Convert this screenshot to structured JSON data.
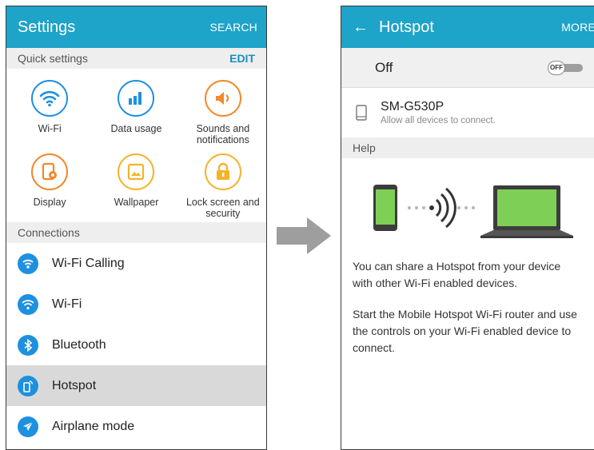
{
  "left_screen": {
    "appbar": {
      "title": "Settings",
      "action": "SEARCH"
    },
    "quick_settings": {
      "header": "Quick settings",
      "edit_label": "EDIT",
      "tiles": [
        {
          "label": "Wi-Fi",
          "icon": "wifi-icon",
          "color": "#1e90e0"
        },
        {
          "label": "Data usage",
          "icon": "bar-chart-icon",
          "color": "#1e90e0"
        },
        {
          "label": "Sounds and\nnotifications",
          "icon": "speaker-icon",
          "color": "#f2882b"
        },
        {
          "label": "Display",
          "icon": "display-gear-icon",
          "color": "#f2882b"
        },
        {
          "label": "Wallpaper",
          "icon": "picture-icon",
          "color": "#f5b32a"
        },
        {
          "label": "Lock screen and\nsecurity",
          "icon": "padlock-icon",
          "color": "#f5b32a"
        }
      ]
    },
    "connections": {
      "header": "Connections",
      "items": [
        {
          "label": "Wi-Fi Calling",
          "icon": "wifi-calling-icon"
        },
        {
          "label": "Wi-Fi",
          "icon": "wifi-icon"
        },
        {
          "label": "Bluetooth",
          "icon": "bluetooth-icon"
        },
        {
          "label": "Hotspot",
          "icon": "hotspot-icon",
          "selected": true
        },
        {
          "label": "Airplane mode",
          "icon": "airplane-icon"
        }
      ]
    }
  },
  "right_screen": {
    "appbar": {
      "title": "Hotspot",
      "action": "MORE",
      "back_icon": "back-arrow-icon"
    },
    "master_toggle": {
      "state_label": "Off",
      "switch_text": "OFF",
      "on": false
    },
    "device": {
      "name": "SM-G530P",
      "subtitle": "Allow all devices to connect.",
      "icon": "phone-outline-icon"
    },
    "help": {
      "header": "Help",
      "paragraphs": [
        "You can share a Hotspot from your device with other Wi-Fi enabled devices.",
        "Start the Mobile Hotspot Wi-Fi router and use the controls on your Wi-Fi enabled device to connect."
      ]
    }
  },
  "colors": {
    "appbar": "#1ea3c9",
    "accent_blue": "#1e90e0",
    "selected_row": "#d9d9d9",
    "section_bg": "#eeeeee",
    "flow_arrow": "#9e9e9e"
  }
}
